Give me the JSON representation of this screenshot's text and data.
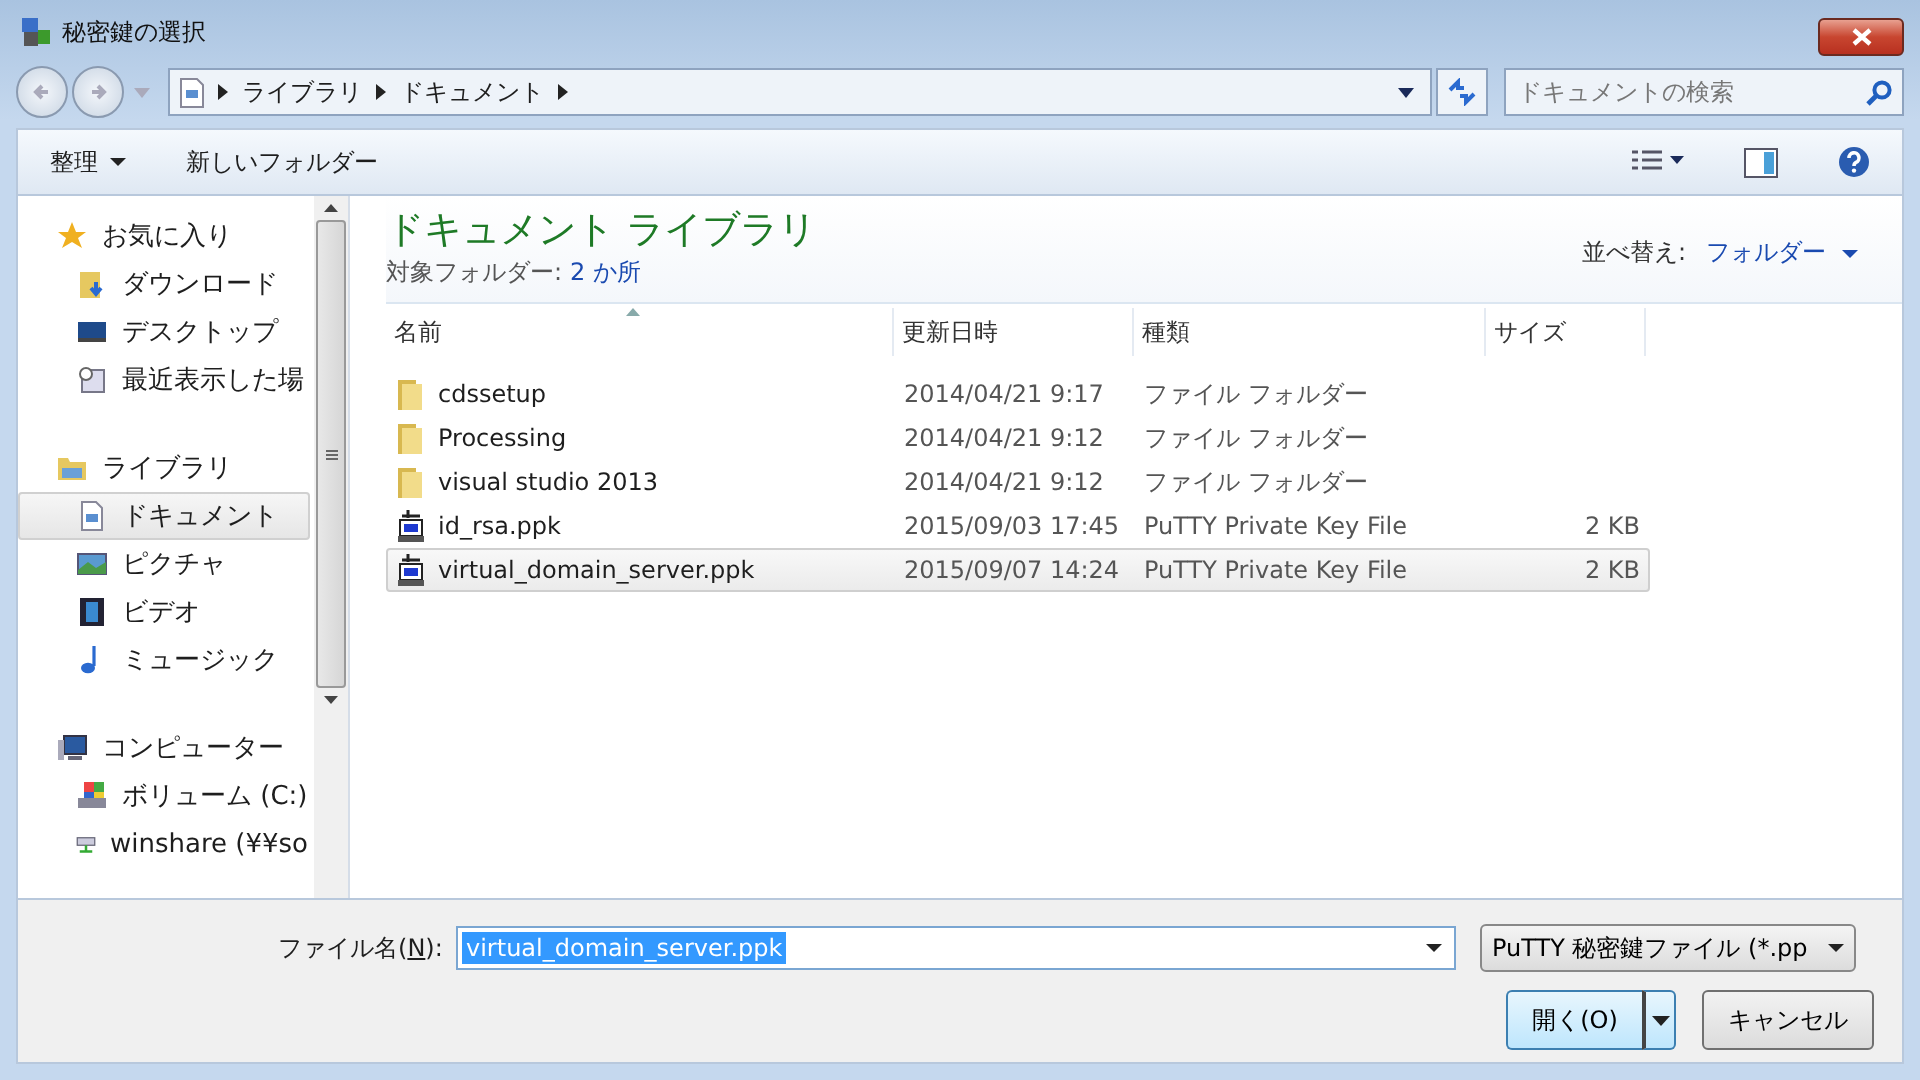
{
  "window": {
    "title": "秘密鍵の選択"
  },
  "breadcrumb": [
    "ライブラリ",
    "ドキュメント"
  ],
  "search": {
    "placeholder": "ドキュメントの検索"
  },
  "toolbar": {
    "organize": "整理",
    "new_folder": "新しいフォルダー"
  },
  "sidebar": {
    "items": [
      {
        "kind": "group",
        "label": "お気に入り",
        "selected": false
      },
      {
        "kind": "item",
        "label": "ダウンロード",
        "selected": false
      },
      {
        "kind": "item",
        "label": "デスクトップ",
        "selected": false
      },
      {
        "kind": "item",
        "label": "最近表示した場",
        "selected": false
      },
      {
        "kind": "group",
        "label": "ライブラリ",
        "selected": false
      },
      {
        "kind": "item",
        "label": "ドキュメント",
        "selected": true
      },
      {
        "kind": "item",
        "label": "ピクチャ",
        "selected": false
      },
      {
        "kind": "item",
        "label": "ビデオ",
        "selected": false
      },
      {
        "kind": "item",
        "label": "ミュージック",
        "selected": false
      },
      {
        "kind": "group",
        "label": "コンピューター",
        "selected": false
      },
      {
        "kind": "item",
        "label": "ボリューム (C:)",
        "selected": false
      },
      {
        "kind": "item",
        "label": "winshare (¥¥so",
        "selected": false
      }
    ]
  },
  "library": {
    "title": "ドキュメント ライブラリ",
    "subtitle_label": "対象フォルダー:",
    "subtitle_link": "2 か所",
    "sort_label": "並べ替え:",
    "sort_value": "フォルダー"
  },
  "table": {
    "columns": [
      "名前",
      "更新日時",
      "種類",
      "サイズ"
    ],
    "rows": [
      {
        "kind": "folder",
        "name": "cdssetup",
        "date": "2014/04/21 9:17",
        "type": "ファイル フォルダー",
        "selected": false
      },
      {
        "kind": "folder",
        "name": "Processing",
        "date": "2014/04/21 9:12",
        "type": "ファイル フォルダー",
        "selected": false
      },
      {
        "kind": "folder",
        "name": "visual studio 2013",
        "date": "2014/04/21 9:12",
        "type": "ファイル フォルダー",
        "selected": false
      },
      {
        "kind": "key",
        "name": "id_rsa.ppk",
        "date": "2015/09/03 17:45",
        "type": "PuTTY Private Key File",
        "size": "2 KB",
        "selected": false
      },
      {
        "kind": "key",
        "name": "virtual_domain_server.ppk",
        "date": "2015/09/07 14:24",
        "type": "PuTTY Private Key File",
        "size": "2 KB",
        "selected": true
      }
    ]
  },
  "footer": {
    "filename_label_before": "ファイル名(",
    "filename_access_key": "N",
    "filename_label_after": "):",
    "filename_value": "virtual_domain_server.ppk",
    "filter": "PuTTY 秘密鍵ファイル (*.pp",
    "open": "開く(O)",
    "cancel": "キャンセル"
  }
}
